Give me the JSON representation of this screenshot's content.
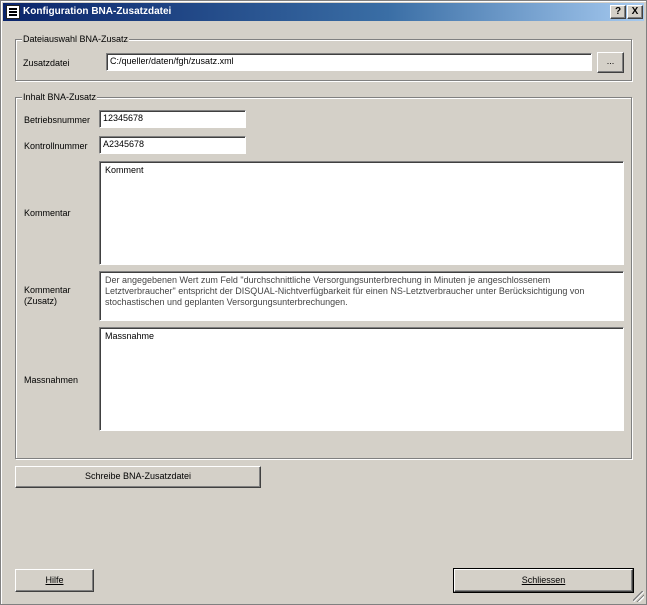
{
  "window": {
    "title": "Konfiguration BNA-Zusatzdatei",
    "help_button": "?",
    "close_button": "X"
  },
  "dateiauswahl": {
    "legend": "Dateiauswahl BNA-Zusatz",
    "zusatzdatei_label": "Zusatzdatei",
    "zusatzdatei_value": "C:/queller/daten/fgh/zusatz.xml",
    "browse_label": "..."
  },
  "inhalt": {
    "legend": "Inhalt BNA-Zusatz",
    "betriebsnummer_label": "Betriebsnummer",
    "betriebsnummer_value": "12345678",
    "kontrollnummer_label": "Kontrollnummer",
    "kontrollnummer_value": "A2345678",
    "kommentar_label": "Kommentar",
    "kommentar_value": "Komment",
    "kommentar_zusatz_label": "Kommentar\n(Zusatz)",
    "kommentar_zusatz_value": "Der angegebenen Wert zum Feld \"durchschnittliche Versorgungsunterbrechung in Minuten je angeschlossenem Letztverbraucher\" entspricht der DISQUAL-Nichtverfügbarkeit für einen NS-Letztverbraucher unter Berücksichtigung von stochastischen und geplanten Versorgungsunterbrechungen.",
    "massnahmen_label": "Massnahmen",
    "massnahmen_value": "Massnahme"
  },
  "actions": {
    "write_label": "Schreibe BNA-Zusatzdatei",
    "help_label": "Hilfe",
    "close_label": "Schliessen"
  }
}
